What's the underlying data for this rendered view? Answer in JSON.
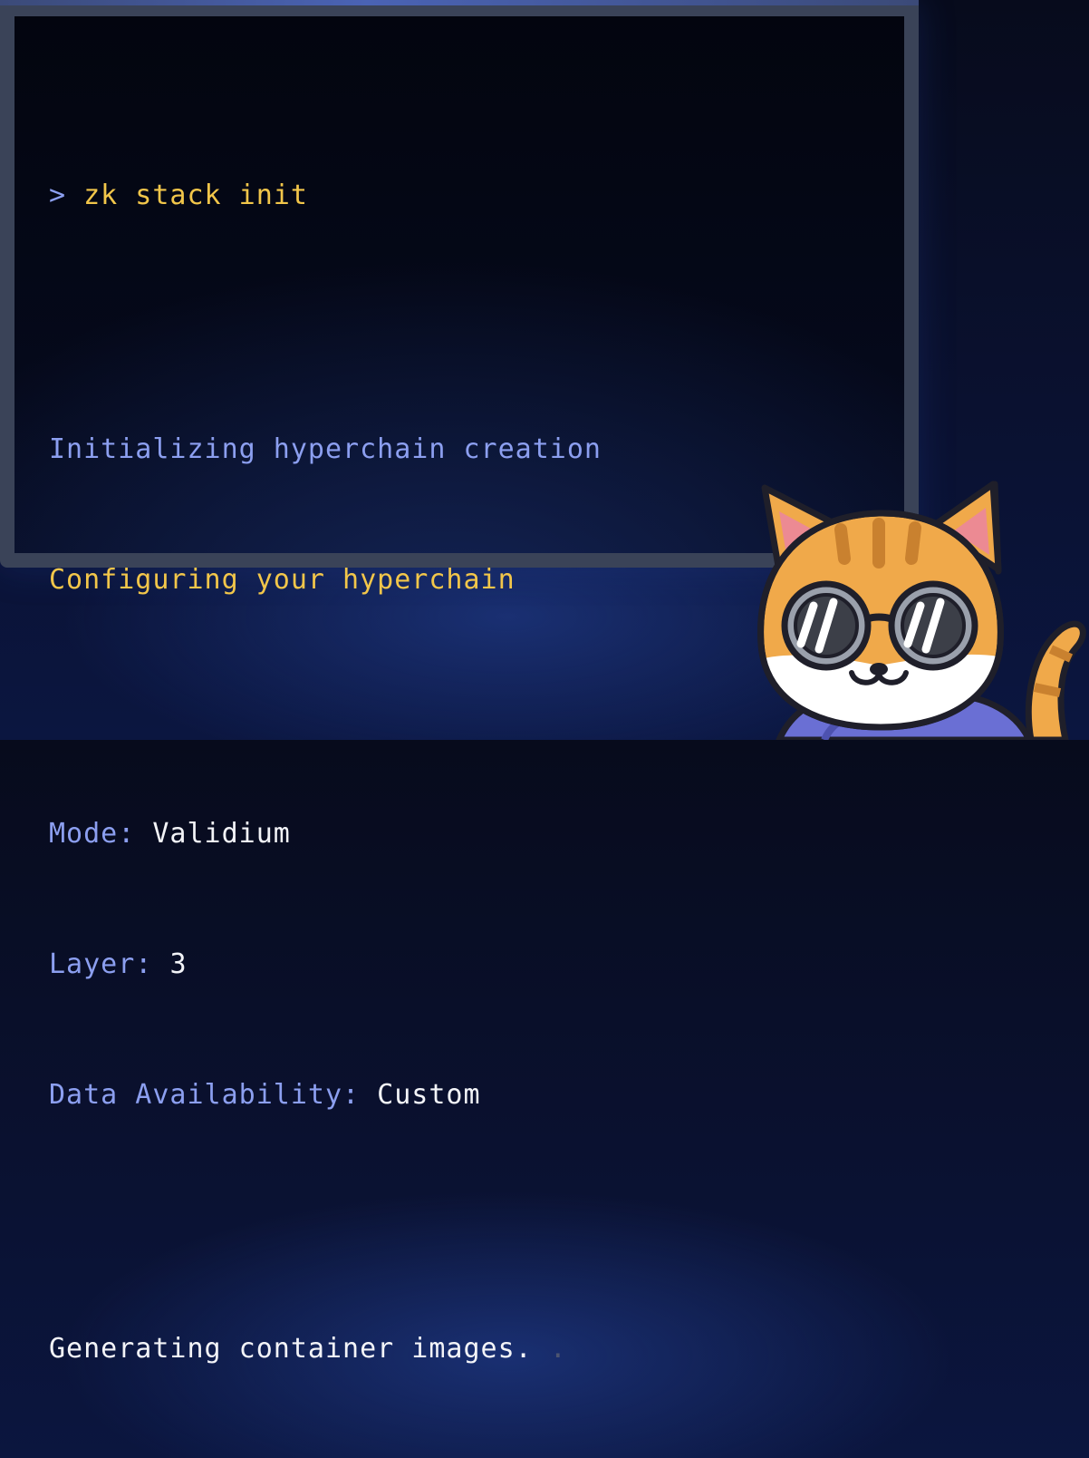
{
  "terminal": {
    "command_prompt": ">",
    "command": "zk stack init",
    "status_initializing": "Initializing hyperchain creation",
    "status_configuring": "Configuring your hyperchain",
    "config": [
      {
        "label": "Mode:",
        "value": "Validium"
      },
      {
        "label": "Layer:",
        "value": "3"
      },
      {
        "label": "Data Availability:",
        "value": "Custom"
      }
    ],
    "progress_text": "Generating container images.",
    "progress_dots": " ."
  },
  "mascot": {
    "icon": "cat-with-sunglasses-icon"
  },
  "colors": {
    "accent_yellow": "#f2c64a",
    "label_blue": "#8c9ff0",
    "text_white": "#f3f4f8",
    "frame": "#3a4358",
    "background": "#070b1c"
  }
}
